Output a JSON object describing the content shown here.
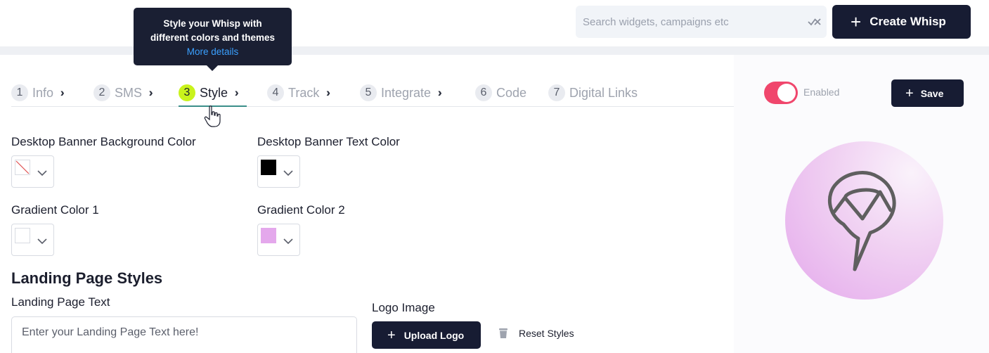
{
  "header": {
    "search_placeholder": "Search widgets, campaigns etc",
    "clear_icon": "close-icon",
    "create_button": "Create Whisp"
  },
  "tooltip": {
    "line1": "Style your Whisp with",
    "line2": "different colors and themes",
    "link": "More details"
  },
  "steps": [
    {
      "num": "1",
      "label": "Info"
    },
    {
      "num": "2",
      "label": "SMS"
    },
    {
      "num": "3",
      "label": "Style"
    },
    {
      "num": "4",
      "label": "Track"
    },
    {
      "num": "5",
      "label": "Integrate"
    },
    {
      "num": "6",
      "label": "Code"
    },
    {
      "num": "7",
      "label": "Digital Links"
    }
  ],
  "active_step": 3,
  "right": {
    "enabled_label": "Enabled",
    "enabled": true,
    "save_button": "Save"
  },
  "fields": {
    "desktop_bg_label": "Desktop Banner Background Color",
    "desktop_bg_value": "none",
    "desktop_text_label": "Desktop Banner Text Color",
    "desktop_text_value": "#000000",
    "gradient1_label": "Gradient Color 1",
    "gradient1_value": "#ffffff",
    "gradient2_label": "Gradient Color 2",
    "gradient2_value": "#e4a8ec"
  },
  "landing": {
    "section_title": "Landing Page Styles",
    "text_label": "Landing Page Text",
    "text_placeholder": "Enter your Landing Page Text here!",
    "logo_label": "Logo Image",
    "upload_button": "Upload Logo",
    "reset_button": "Reset Styles"
  },
  "colors": {
    "primary_dark": "#171c33",
    "toggle_on": "#f0466c",
    "active_step": "#c9f31c",
    "link": "#3aa0ff"
  }
}
